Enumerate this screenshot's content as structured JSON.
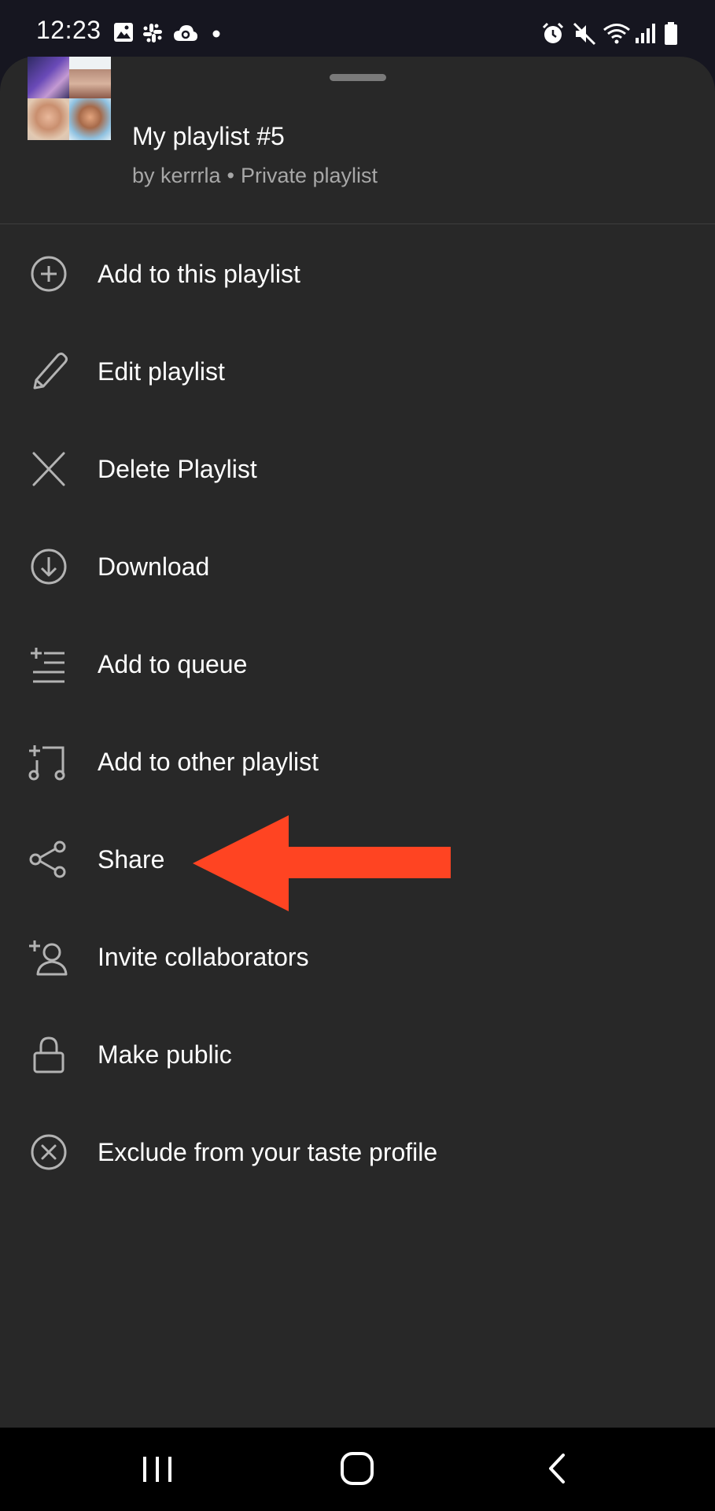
{
  "status_bar": {
    "time": "12:23",
    "left_icons": [
      "gallery-icon",
      "slack-icon",
      "cloud-icon",
      "dot-icon"
    ],
    "right_icons": [
      "alarm-icon",
      "mute-icon",
      "wifi-icon",
      "signal-icon",
      "battery-icon"
    ]
  },
  "playlist": {
    "title": "My playlist #5",
    "owner": "by kerrrla",
    "separator": "•",
    "visibility": "Private playlist"
  },
  "menu": {
    "items": [
      {
        "label": "Add to this playlist",
        "icon": "add-circle-icon"
      },
      {
        "label": "Edit playlist",
        "icon": "pencil-icon"
      },
      {
        "label": "Delete Playlist",
        "icon": "close-x-icon"
      },
      {
        "label": "Download",
        "icon": "download-icon"
      },
      {
        "label": "Add to queue",
        "icon": "add-to-queue-icon"
      },
      {
        "label": "Add to other playlist",
        "icon": "add-music-icon"
      },
      {
        "label": "Share",
        "icon": "share-icon"
      },
      {
        "label": "Invite collaborators",
        "icon": "add-person-icon"
      },
      {
        "label": "Make public",
        "icon": "lock-icon"
      },
      {
        "label": "Exclude from your taste profile",
        "icon": "circle-x-icon"
      }
    ]
  },
  "annotation": {
    "arrow_color": "#ff4422",
    "points_to": "Share"
  },
  "nav_bar": {
    "buttons": [
      "recents-icon",
      "home-icon",
      "back-icon"
    ]
  },
  "colors": {
    "sheet_background": "#282828",
    "status_background": "#161620",
    "primary_text": "#ffffff",
    "secondary_text": "#a7a7a7"
  }
}
